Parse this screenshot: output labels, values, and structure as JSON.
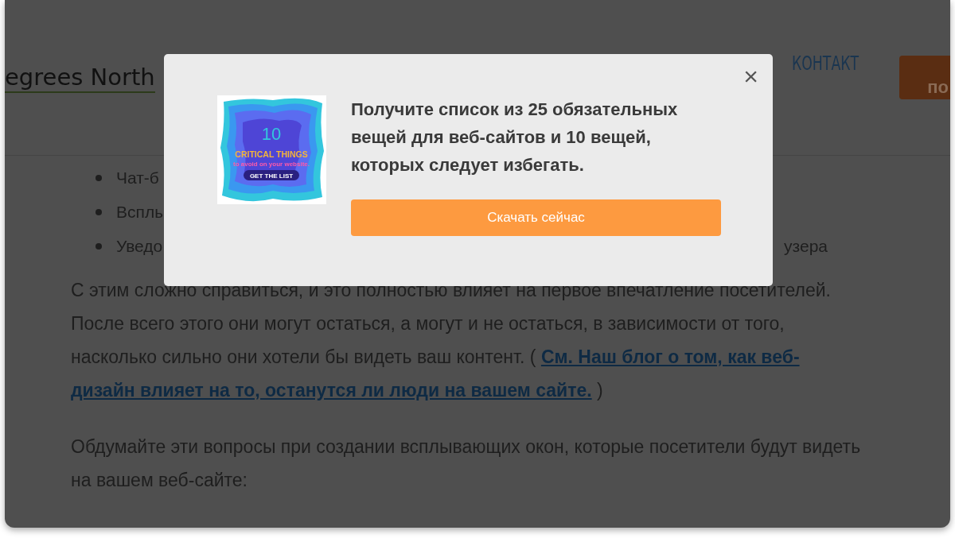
{
  "page": {
    "logo": "egrees North",
    "nav": [
      {
        "label": "КОНТАКТ"
      }
    ],
    "header_button": "по",
    "bullets": [
      {
        "start": "Чат-б"
      },
      {
        "start": "Всплы"
      },
      {
        "start": "Уведо",
        "end": "узера"
      }
    ],
    "paragraphs": [
      {
        "text": "С этим сложно справиться, и это полностью влияет на первое впечатление посетителей. После всего этого они могут остаться, а могут и не остаться, в зависимости от того, насколько сильно они хотели бы видеть ваш контент. ( ",
        "link_lines": [
          "См. Наш блог о том, как веб-",
          "дизайн влияет на то, останутся ли люди на вашем сайте."
        ],
        "after": " )"
      },
      {
        "text": "Обдумайте эти вопросы при создании всплывающих окон, которые посетители будут видеть на вашем веб-сайте:"
      }
    ]
  },
  "modal": {
    "close": "×",
    "graphic": {
      "number": "10",
      "title": "CRITICAL THINGS",
      "subtitle": "to avoid on your website.",
      "cta": "GET THE LIST"
    },
    "heading": "Получите список из 25 обязательных вещей для веб-сайтов и 10 вещей, которых следует избегать.",
    "button": "Скачать сейчас"
  }
}
